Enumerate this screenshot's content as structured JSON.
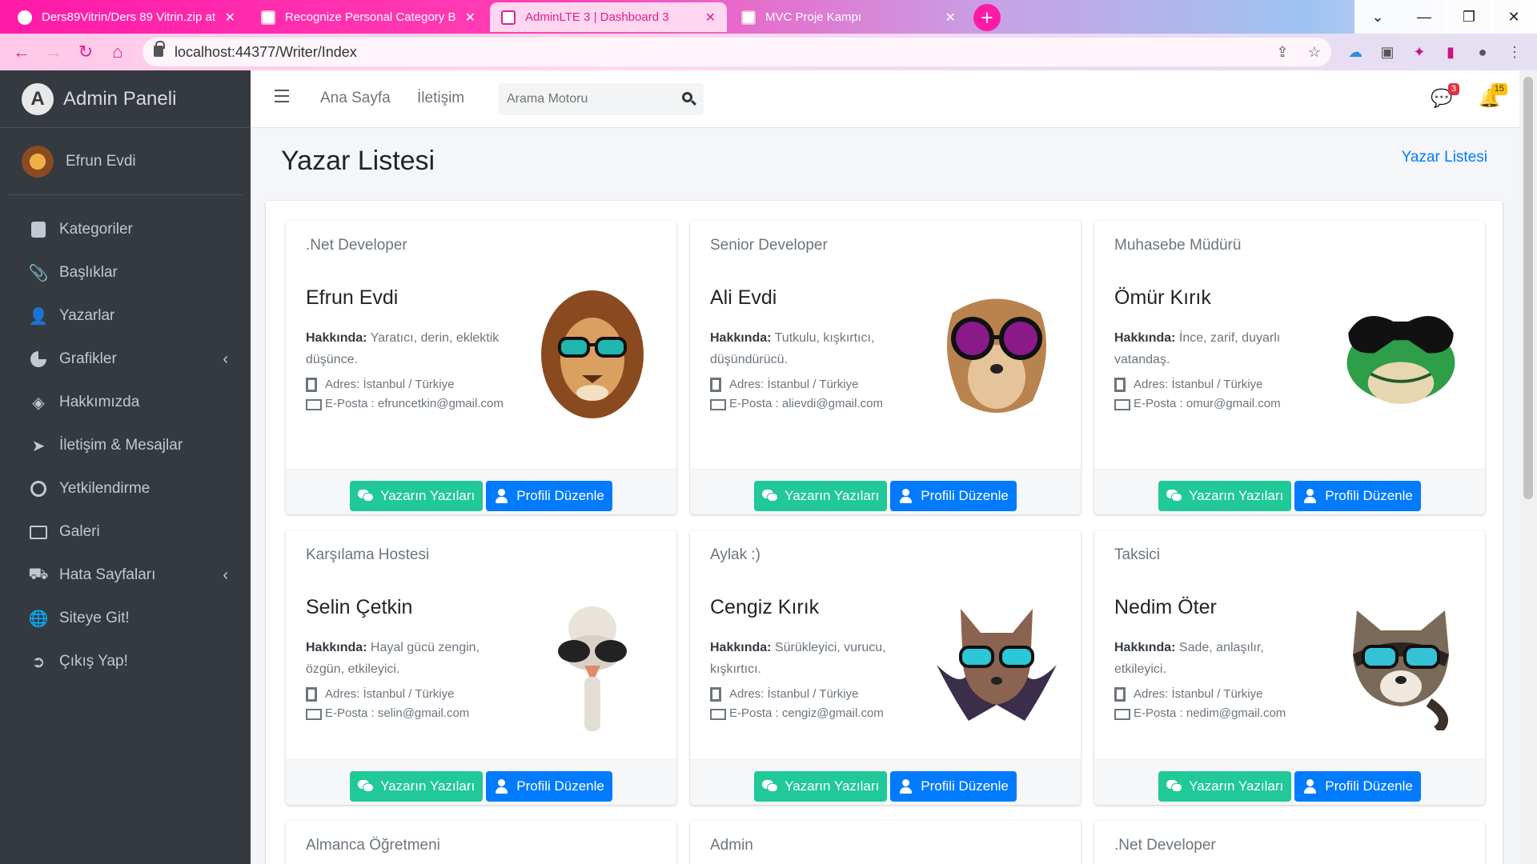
{
  "browser": {
    "tabs": [
      {
        "title": "Ders89Vitrin/Ders 89 Vitrin.zip at",
        "active": false
      },
      {
        "title": "Recognize Personal Category Boo",
        "active": false
      },
      {
        "title": "AdminLTE 3 | Dashboard 3",
        "active": true
      },
      {
        "title": "MVC Proje Kampı",
        "active": false
      }
    ],
    "url": "localhost:44377/Writer/Index"
  },
  "sidebar": {
    "brand": "Admin Paneli",
    "user": "Efrun Evdi",
    "items": [
      {
        "label": "Kategoriler",
        "icon": "clipboard-icon"
      },
      {
        "label": "Başlıklar",
        "icon": "paperclip-icon"
      },
      {
        "label": "Yazarlar",
        "icon": "user-edit-icon"
      },
      {
        "label": "Grafikler",
        "icon": "chart-pie-icon"
      },
      {
        "label": "Hakkımızda",
        "icon": "layers-icon"
      },
      {
        "label": "İletişim & Mesajlar",
        "icon": "paper-plane-icon"
      },
      {
        "label": "Yetkilendirme",
        "icon": "award-icon"
      },
      {
        "label": "Galeri",
        "icon": "image-icon"
      },
      {
        "label": "Hata Sayfaları",
        "icon": "ambulance-icon"
      },
      {
        "label": "Siteye Git!",
        "icon": "globe-icon"
      },
      {
        "label": "Çıkış Yap!",
        "icon": "sign-out-icon"
      }
    ]
  },
  "topnav": {
    "home": "Ana Sayfa",
    "contact": "İletişim",
    "search_placeholder": "Arama Motoru",
    "messages_count": "3",
    "notifications_count": "15"
  },
  "page": {
    "title": "Yazar Listesi",
    "breadcrumb": "Yazar Listesi",
    "about_label": "Hakkında:",
    "btn_posts": "Yazarın Yazıları",
    "btn_edit": "Profili Düzenle"
  },
  "writers": [
    {
      "title": ".Net Developer",
      "name": "Efrun Evdi",
      "about": "Yaratıcı, derin, eklektik düşünce.",
      "address": "Adres: İstanbul / Türkiye",
      "email": "E-Posta : efruncetkin@gmail.com",
      "avatar": "lion-with-sunglasses"
    },
    {
      "title": "Senior Developer",
      "name": "Ali Evdi",
      "about": "Tutkulu, kışkırtıcı, düşündürücü.",
      "address": "Adres: İstanbul / Türkiye",
      "email": "E-Posta : alievdi@gmail.com",
      "avatar": "meerkat-with-sunglasses"
    },
    {
      "title": "Muhasebe Müdürü",
      "name": "Ömür Kırık",
      "about": "İnce, zarif, duyarlı vatandaş.",
      "address": "Adres: İstanbul / Türkiye",
      "email": "E-Posta : omur@gmail.com",
      "avatar": "frog-with-sunglasses"
    },
    {
      "title": "Karşılama Hostesi",
      "name": "Selin Çetkin",
      "about": "Hayal gücü zengin, özgün, etkileyici.",
      "address": "Adres: İstanbul / Türkiye",
      "email": "E-Posta : selin@gmail.com",
      "avatar": "ostrich-with-sunglasses"
    },
    {
      "title": "Aylak :)",
      "name": "Cengiz Kırık",
      "about": "Sürükleyici, vurucu, kışkırtıcı.",
      "address": "Adres: İstanbul / Türkiye",
      "email": "E-Posta : cengiz@gmail.com",
      "avatar": "bat-with-sunglasses"
    },
    {
      "title": "Taksici",
      "name": "Nedim Öter",
      "about": "Sade, anlaşılır, etkileyici.",
      "address": "Adres: İstanbul / Türkiye",
      "email": "E-Posta : nedim@gmail.com",
      "avatar": "raccoon-with-sunglasses"
    },
    {
      "title": "Almanca Öğretmeni"
    },
    {
      "title": "Admin"
    },
    {
      "title": ".Net Developer"
    }
  ],
  "colors": {
    "sidebar_bg": "#343a40",
    "accent_green": "#20c997",
    "accent_blue": "#007bff",
    "badge_red": "#dc3545",
    "badge_yellow": "#ffc107"
  }
}
